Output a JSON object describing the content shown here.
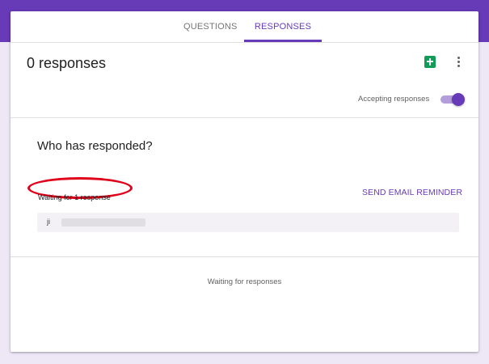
{
  "tabs": [
    {
      "label": "QUESTIONS",
      "active": false
    },
    {
      "label": "RESPONSES",
      "active": true
    }
  ],
  "summary": {
    "title": "0 responses",
    "accepting_label": "Accepting responses",
    "accepting": true
  },
  "icons": {
    "sheets": "google-sheets-icon",
    "more": "more-vert-icon"
  },
  "respondents_section": {
    "heading": "Who has responded?",
    "waiting_count": "Waiting for 1 response",
    "reminder_button": "SEND EMAIL REMINDER",
    "rows": [
      {
        "initials": "ji"
      }
    ]
  },
  "footer": {
    "waiting_text": "Waiting for responses"
  },
  "colors": {
    "accent": "#673ab7",
    "background": "#ede7f6",
    "annotation": "#e0001a",
    "sheets_green": "#0f9d58"
  }
}
